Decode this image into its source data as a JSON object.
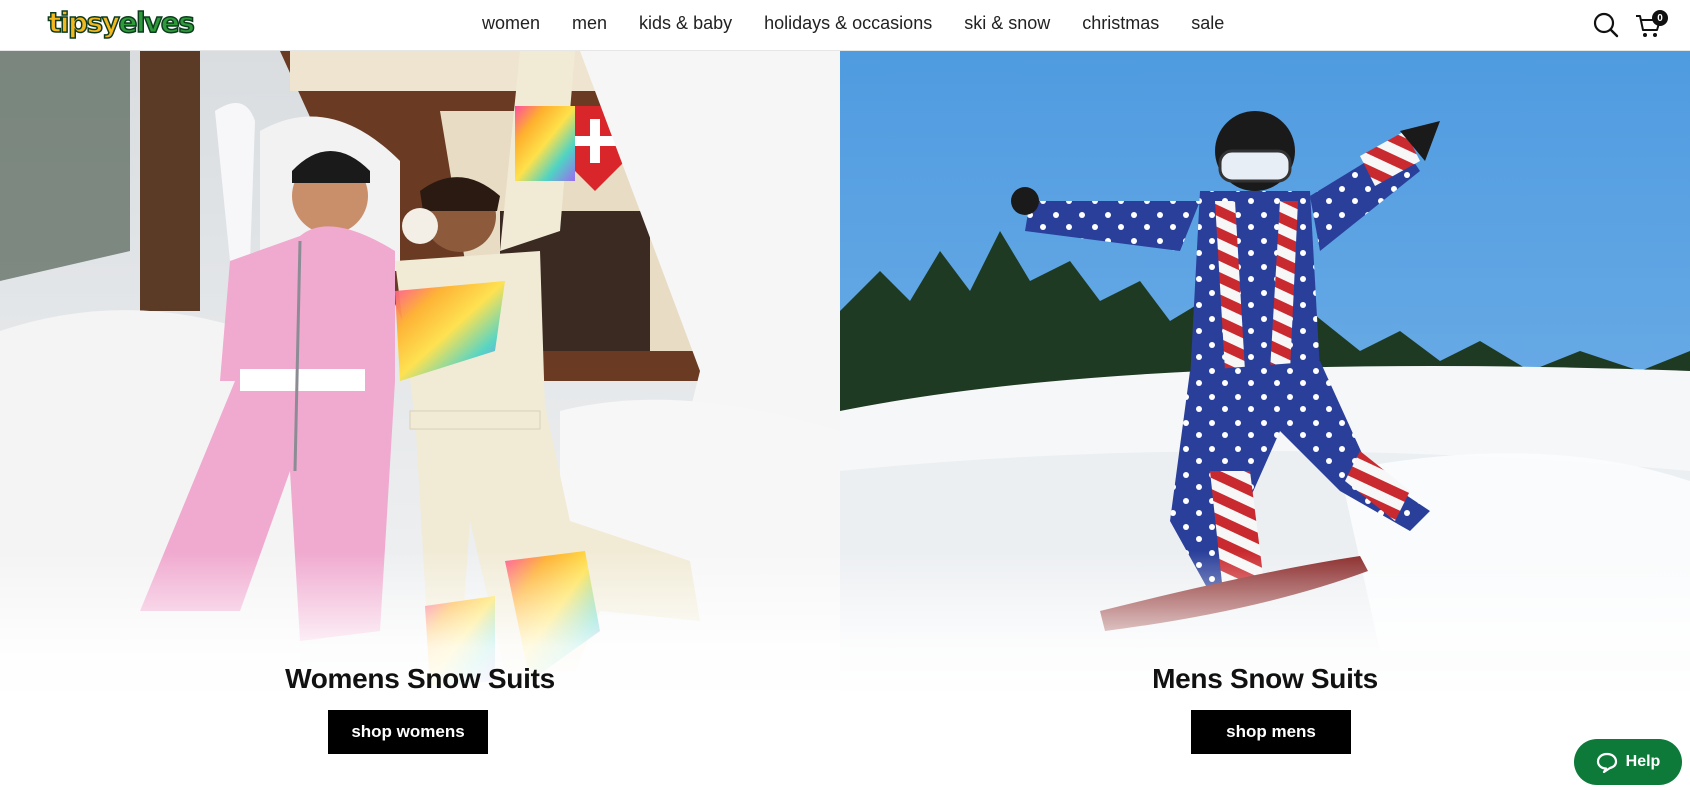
{
  "header": {
    "logo_text_1": "tipsy",
    "logo_text_2": "elves",
    "nav": [
      "women",
      "men",
      "kids & baby",
      "holidays & occasions",
      "ski & snow",
      "christmas",
      "sale"
    ],
    "cart_count": "0",
    "icons": {
      "search": "search-icon",
      "cart": "cart-icon"
    }
  },
  "panels": {
    "womens": {
      "title": "Womens Snow Suits",
      "button": "shop womens"
    },
    "mens": {
      "title": "Mens Snow Suits",
      "button": "shop mens"
    }
  },
  "help": {
    "label": "Help",
    "icon": "chat-bubble-icon"
  },
  "colors": {
    "brand_green": "#0d7a3a",
    "logo_yellow": "#f2b81e",
    "button_black": "#000000"
  }
}
